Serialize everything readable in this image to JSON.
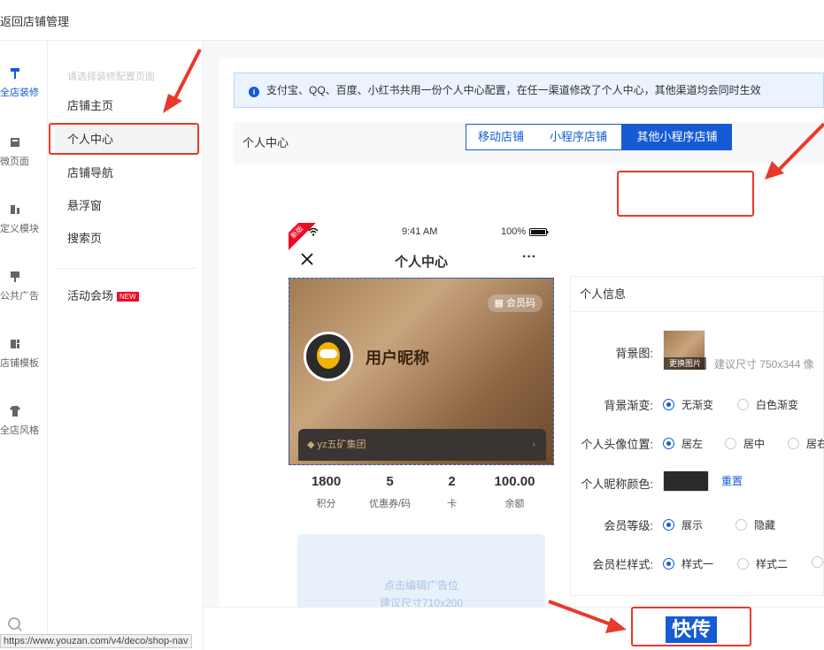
{
  "topbar": {
    "back_label": "返回店铺管理"
  },
  "icon_nav": [
    {
      "label": "全店装修",
      "icon": "brush-icon",
      "active": true
    },
    {
      "label": "微页面",
      "icon": "page-icon"
    },
    {
      "label": "定义模块",
      "icon": "module-icon"
    },
    {
      "label": "公共广告",
      "icon": "billboard-icon"
    },
    {
      "label": "店铺模板",
      "icon": "template-icon"
    },
    {
      "label": "全店风格",
      "icon": "tshirt-icon"
    }
  ],
  "menu": {
    "hint": "请选择装修配置页面",
    "items": [
      "店铺主页",
      "个人中心",
      "店铺导航",
      "悬浮窗",
      "搜索页"
    ],
    "event_label": "活动会场",
    "new_badge": "NEW"
  },
  "notice": "支付宝、QQ、百度、小红书共用一份个人中心配置，在任一渠道修改了个人中心，其他渠道均会同时生效",
  "section_title": "个人中心",
  "segments": [
    "移动店铺",
    "小程序店铺",
    "其他小程序店铺"
  ],
  "phone": {
    "ribbon": "新版",
    "time": "9:41 AM",
    "battery": "100%",
    "title": "个人中心",
    "more": "···",
    "member_code": "会员码",
    "nickname": "用户昵称",
    "vip_bar": "yz五矿集团",
    "stats": [
      {
        "value": "1800",
        "label": "积分"
      },
      {
        "value": "5",
        "label": "优惠券/码"
      },
      {
        "value": "2",
        "label": "卡"
      },
      {
        "value": "100.00",
        "label": "余额"
      }
    ],
    "ad_line1": "点击编辑广告位",
    "ad_line2": "建议尺寸710x200"
  },
  "panel": {
    "title": "个人信息",
    "bg_label": "背景图:",
    "change_image": "更换图片",
    "size_hint": "建议尺寸 750x344 像",
    "gradient_label": "背景渐变:",
    "gradient_opts": [
      "无渐变",
      "白色渐变"
    ],
    "avatar_pos_label": "个人头像位置:",
    "avatar_pos_opts": [
      "居左",
      "居中",
      "居右"
    ],
    "name_color_label": "个人昵称颜色:",
    "name_color": "#2a2a2a",
    "reset": "重置",
    "level_label": "会员等级:",
    "level_opts": [
      "展示",
      "隐藏"
    ],
    "bar_style_label": "会员栏样式:",
    "bar_style_opts": [
      "样式一",
      "样式二"
    ]
  },
  "save_button": "快传",
  "status_url": "https://www.youzan.com/v4/deco/shop-nav",
  "colors": {
    "accent": "#155bd4",
    "annotation": "#e8392b"
  }
}
